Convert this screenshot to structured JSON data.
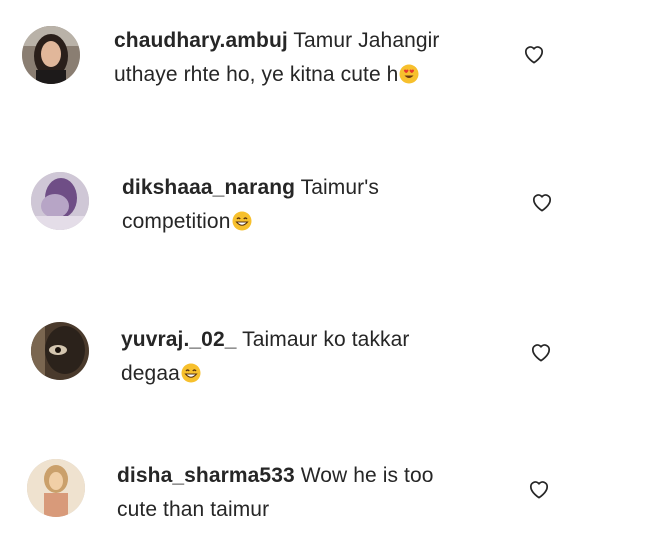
{
  "comments": [
    {
      "username": "chaudhary.ambuj",
      "line1": "Tamur Jahangir",
      "line2": "uthaye rhte ho, ye kitna cute h",
      "emoji": "heart-eyes-emoji",
      "like_icon": "heart-outline-icon"
    },
    {
      "username": "dikshaaa_narang",
      "line1": "Taimur's",
      "line2": "competition",
      "emoji": "grinning-emoji",
      "like_icon": "heart-outline-icon"
    },
    {
      "username": "yuvraj._02_",
      "line1": "Taimaur ko takkar",
      "line2": "degaa",
      "emoji": "grinning-emoji",
      "like_icon": "heart-outline-icon"
    },
    {
      "username": "disha_sharma533",
      "line1": "Wow he is too",
      "line2": "cute than taimur",
      "emoji": "",
      "like_icon": "heart-outline-icon"
    }
  ],
  "colors": {
    "text": "#262626",
    "icon": "#262626",
    "emoji_face": "#f7c02d"
  }
}
